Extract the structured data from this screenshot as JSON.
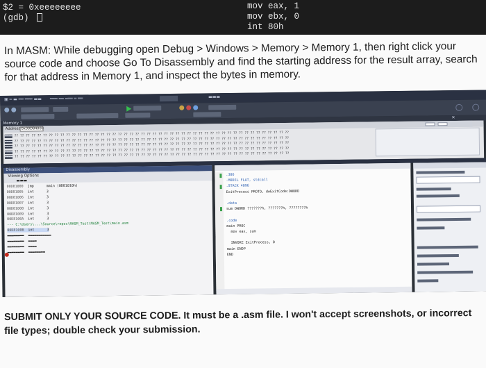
{
  "terminal": {
    "left_lines": [
      "$2 = 0xeeeeeeee",
      "(gdb) "
    ],
    "right_lines": [
      "mov eax, 1",
      "mov ebx, 0",
      "int 80h"
    ]
  },
  "instructions": {
    "text": "In MASM: While debugging open Debug > Windows > Memory > Memory 1, then right click your source code and choose Go To Disassembly and find the starting address for the result array, search for that address in Memory 1, and inspect the bytes in memory."
  },
  "ide": {
    "memory_window_title": "Memory 1",
    "address_label": "Address:",
    "address_value": "0x00D84000",
    "disassembly_title": "Disassembly",
    "viewing_options_label": "Viewing Options",
    "source_file_comment": "--- C:\\Users\\...\\Source\\repos\\MASM_Test\\MASM_Test\\main.asm",
    "code_lines": [
      ".386",
      ".MODEL FLAT, stdcall",
      ".STACK 4096",
      "ExitProcess PROTO, dwExitCode:DWORD",
      "",
      ".data",
      "sum DWORD ???????h, ???????h, ????????h",
      "",
      ".code",
      "main PROC",
      "  mov eax, sum",
      "",
      "  INVOKE ExitProcess, 0",
      "main ENDP",
      "END"
    ],
    "disasm_rows": [
      [
        "00D81000",
        "jmp",
        "main (0D81010h)"
      ],
      [
        "00D81005",
        "int",
        "3"
      ],
      [
        "00D81006",
        "int",
        "3"
      ],
      [
        "00D81007",
        "int",
        "3"
      ],
      [
        "00D81008",
        "int",
        "3"
      ],
      [
        "00D81009",
        "int",
        "3"
      ],
      [
        "00D8100A",
        "int",
        "3"
      ],
      [
        "00D8100B",
        "int",
        "3"
      ]
    ]
  },
  "footer": {
    "text": "SUBMIT ONLY YOUR SOURCE CODE. It must be a .asm file. I won't accept screenshots, or incorrect file types; double check your submission."
  }
}
